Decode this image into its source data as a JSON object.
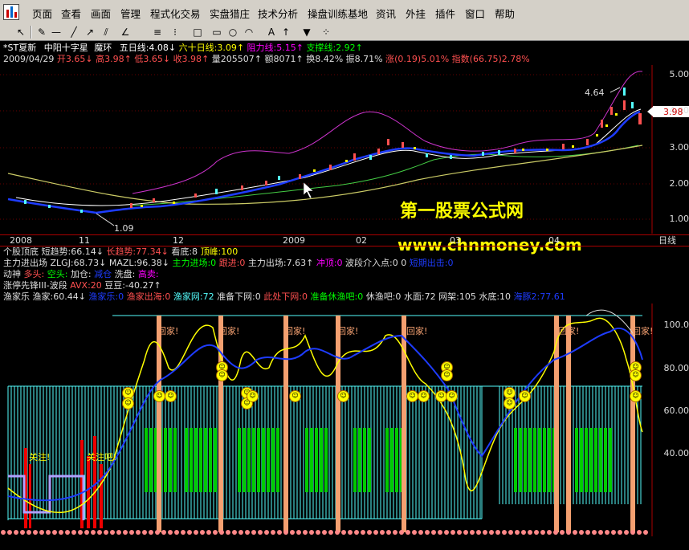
{
  "menu": {
    "items": [
      "页面",
      "查看",
      "画面",
      "管理",
      "程式化交易",
      "实盘猎庄",
      "技术分析",
      "操盘训练基地",
      "资讯",
      "外挂",
      "插件",
      "窗口",
      "帮助"
    ]
  },
  "toolbar": {
    "tools": [
      "pointer-icon",
      "pen-icon",
      "hline-icon",
      "line-icon",
      "arrow-line-icon",
      "channel-icon",
      "angle-icon",
      "rect-icon",
      "ellipse-icon",
      "arc-icon",
      "text-icon",
      "arrow-icon",
      "palette-icon"
    ],
    "text_tool": "A"
  },
  "kline_header": {
    "stock": "*ST夏新",
    "indicator": "中阳十字星",
    "item2": "魔环",
    "ma5": "五日线:4.08",
    "ma60": "六十日线:3.09",
    "resist": "阻力线:5.15",
    "support": "支撑线:2.92"
  },
  "quote_line": {
    "date": "2009/04/29",
    "open": "开3.65",
    "high": "高3.98",
    "low": "低3.65",
    "close": "收3.98",
    "volume": "量205507",
    "amount": "额8071",
    "turnover": "换8.42%",
    "amplitude": "振8.71%",
    "change": "涨(0.19)5.01%",
    "index": "指数(66.75)2.78%"
  },
  "kline": {
    "price_ticks": [
      "5.00",
      "4.00",
      "3.00",
      "2.00",
      "1.00"
    ],
    "max_label": "4.64",
    "min_label": "1.09",
    "current_price": "3.98",
    "watermark_title": "第一股票公式网",
    "watermark_url": "www.chnmoney.com",
    "date_axis": [
      "2008",
      "11",
      "12",
      "2009",
      "02",
      "03",
      "04"
    ],
    "period": "日线"
  },
  "indicator_rows": {
    "r1": [
      "个股顶底",
      "短趋势:66.14",
      "长趋势:77.34",
      "看底:8",
      "顶峰:100"
    ],
    "r2": [
      "主力进出场",
      "ZLGJ:68.73",
      "MAZL:96.38",
      "主力进场:0",
      "跟进:0",
      "主力出场:7.63",
      "冲顶:0",
      "波段介入点:0",
      "0",
      "短期出击:0"
    ],
    "r3": [
      "动神",
      "多头:",
      "空头:",
      "加仓:",
      "减仓",
      "洗盘:",
      "高卖:"
    ],
    "r4": [
      "涨停先锋III-波段",
      "AVX:20",
      "豆豆:",
      "-40.27"
    ],
    "r5": [
      "渔家乐",
      "渔家:60.44",
      "渔家乐:0",
      "渔家出海:0",
      "渔家网:72",
      "准备下网:0",
      "此处下网:0",
      "准备休渔吧:0",
      "休渔吧:0",
      "水面:72",
      "网架:105",
      "水底:10",
      "海豚2:77.61"
    ]
  },
  "lower_panel": {
    "y_ticks": [
      "100.0",
      "80.00",
      "60.00",
      "40.00"
    ],
    "home_label": "回家!",
    "attention_label": "关注!",
    "attention_label2": "关注吧!"
  },
  "colors": {
    "bg": "#000000",
    "up": "#ff5050",
    "down": "#54fcfc",
    "yellow": "#ffff00",
    "magenta": "#ff00ff",
    "green": "#00ff00",
    "blue": "#1e3cff",
    "watermark": "#ffff00"
  }
}
